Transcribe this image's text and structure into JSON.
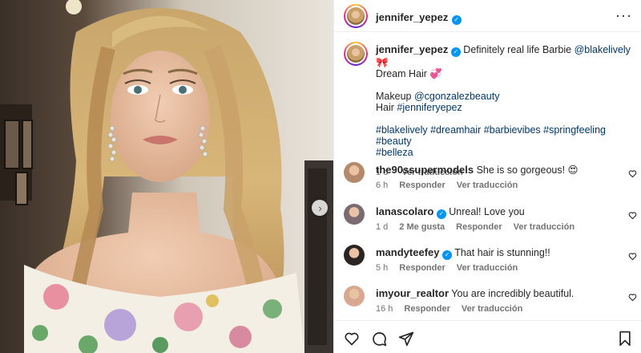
{
  "post": {
    "username": "jennifer_yepez",
    "more_icon": "more-horizontal-icon",
    "caption": {
      "line1": "Definitely real life Barbie",
      "mention1": "@blakelively",
      "emoji1": "🎀",
      "line2": "Dream Hair",
      "emoji2": "💞",
      "makeup_label": "Makeup",
      "makeup_mention": "@cgonzalezbeauty",
      "hair_label": "Hair",
      "hair_tag": "#jenniferyepez",
      "hashtags_line1": "#blakelively #dreamhair #barbievibes #springfeeling #beauty",
      "hashtags_line2": "#belleza"
    },
    "time": "1 d",
    "translate": "Ver traducción"
  },
  "comments": [
    {
      "user": "the90ssupermodels",
      "verified": false,
      "text": "She is so gorgeous! 😍",
      "time": "6 h",
      "likes": "",
      "reply": "Responder",
      "translate": "Ver traducción",
      "avatar_color": "#b48a6a"
    },
    {
      "user": "lanascolaro",
      "verified": true,
      "text": "Unreal! Love you",
      "time": "1 d",
      "likes": "2 Me gusta",
      "reply": "Responder",
      "translate": "Ver traducción",
      "avatar_color": "#7a6a72"
    },
    {
      "user": "mandyteefey",
      "verified": true,
      "text": "That hair is stunning!!",
      "time": "5 h",
      "likes": "",
      "reply": "Responder",
      "translate": "Ver traducción",
      "avatar_color": "#2a2422"
    },
    {
      "user": "imyour_realtor",
      "verified": false,
      "text": "You are incredibly beautiful.",
      "time": "16 h",
      "likes": "",
      "reply": "Responder",
      "translate": "Ver traducción",
      "avatar_color": "#d8a890"
    }
  ],
  "icons": {
    "like": "heart-icon",
    "comment": "comment-icon",
    "share": "share-icon",
    "save": "bookmark-icon",
    "next": "chevron-right-icon"
  },
  "colors": {
    "link": "#00376b",
    "verified": "#0095f6",
    "muted": "#737373",
    "text": "#262626"
  }
}
